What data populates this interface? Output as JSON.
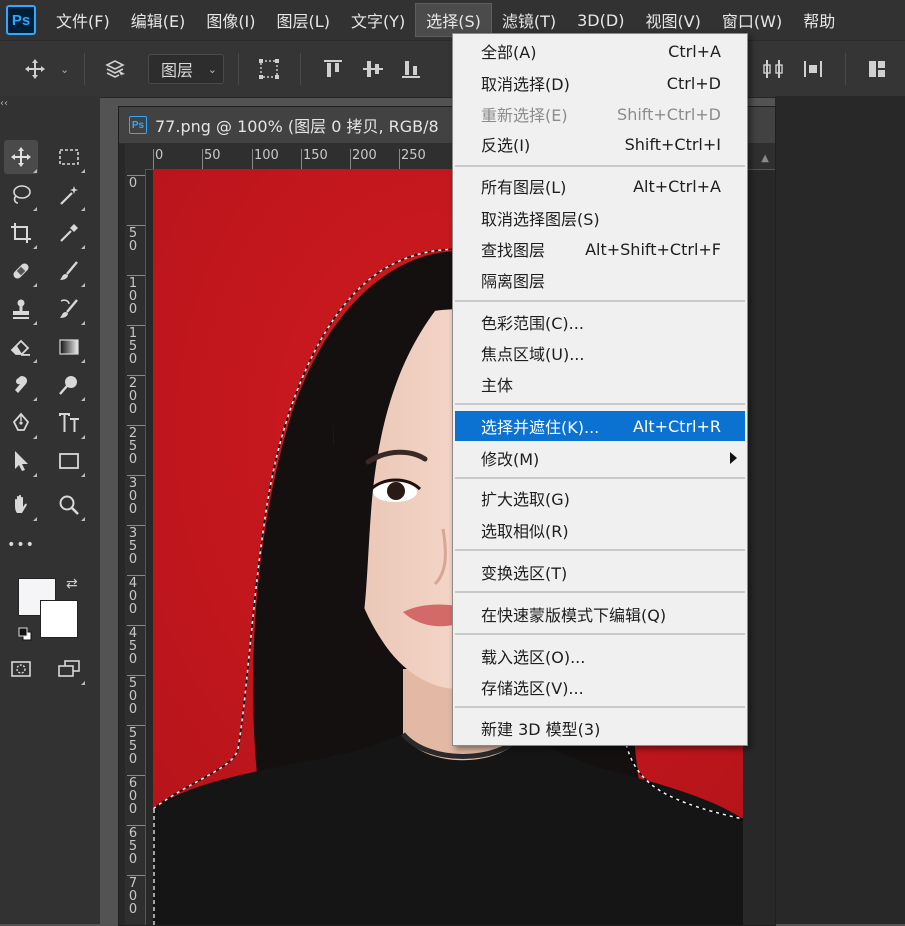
{
  "app": {
    "logo": "Ps"
  },
  "menubar": {
    "items": [
      "文件(F)",
      "编辑(E)",
      "图像(I)",
      "图层(L)",
      "文字(Y)",
      "选择(S)",
      "滤镜(T)",
      "3D(D)",
      "视图(V)",
      "窗口(W)",
      "帮助"
    ],
    "active_index": 5
  },
  "options_bar": {
    "layer_select_value": "图层",
    "icons": [
      "move-icon",
      "auto-select-layers-icon",
      "transform-controls-icon",
      "align-top-icon",
      "align-vcenter-icon",
      "align-bottom-icon",
      "distribute-icon",
      "distribute-h-icon",
      "arrange-icon"
    ]
  },
  "toolbar": {
    "collapse_label": "‹‹",
    "more_label": "•••",
    "foreground_color": "#f5f5f7",
    "background_color": "#ffffff"
  },
  "document": {
    "title": "77.png @ 100% (图层 0 拷贝, RGB/8",
    "ps_icon": "Ps",
    "ruler_top_labels": [
      "0",
      "50",
      "100",
      "150",
      "200",
      "250"
    ],
    "ruler_left_labels": [
      "0",
      "50",
      "100",
      "150",
      "200",
      "250",
      "300",
      "350",
      "400",
      "450",
      "500",
      "550",
      "600",
      "650",
      "700"
    ],
    "canvas_background": "#c3161c"
  },
  "select_menu": {
    "items": [
      {
        "label": "全部(A)",
        "shortcut": "Ctrl+A"
      },
      {
        "label": "取消选择(D)",
        "shortcut": "Ctrl+D"
      },
      {
        "label": "重新选择(E)",
        "shortcut": "Shift+Ctrl+D",
        "disabled": true
      },
      {
        "label": "反选(I)",
        "shortcut": "Shift+Ctrl+I"
      },
      {
        "label": "所有图层(L)",
        "shortcut": "Alt+Ctrl+A"
      },
      {
        "label": "取消选择图层(S)",
        "shortcut": ""
      },
      {
        "label": "查找图层",
        "shortcut": "Alt+Shift+Ctrl+F"
      },
      {
        "label": "隔离图层",
        "shortcut": ""
      },
      {
        "label": "色彩范围(C)...",
        "shortcut": ""
      },
      {
        "label": "焦点区域(U)...",
        "shortcut": ""
      },
      {
        "label": "主体",
        "shortcut": ""
      },
      {
        "label": "选择并遮住(K)...",
        "shortcut": "Alt+Ctrl+R",
        "highlighted": true
      },
      {
        "label": "修改(M)",
        "shortcut": "",
        "submenu": true
      },
      {
        "label": "扩大选取(G)",
        "shortcut": ""
      },
      {
        "label": "选取相似(R)",
        "shortcut": ""
      },
      {
        "label": "变换选区(T)",
        "shortcut": ""
      },
      {
        "label": "在快速蒙版模式下编辑(Q)",
        "shortcut": ""
      },
      {
        "label": "载入选区(O)...",
        "shortcut": ""
      },
      {
        "label": "存储选区(V)...",
        "shortcut": ""
      },
      {
        "label": "新建 3D 模型(3)",
        "shortcut": ""
      }
    ]
  }
}
